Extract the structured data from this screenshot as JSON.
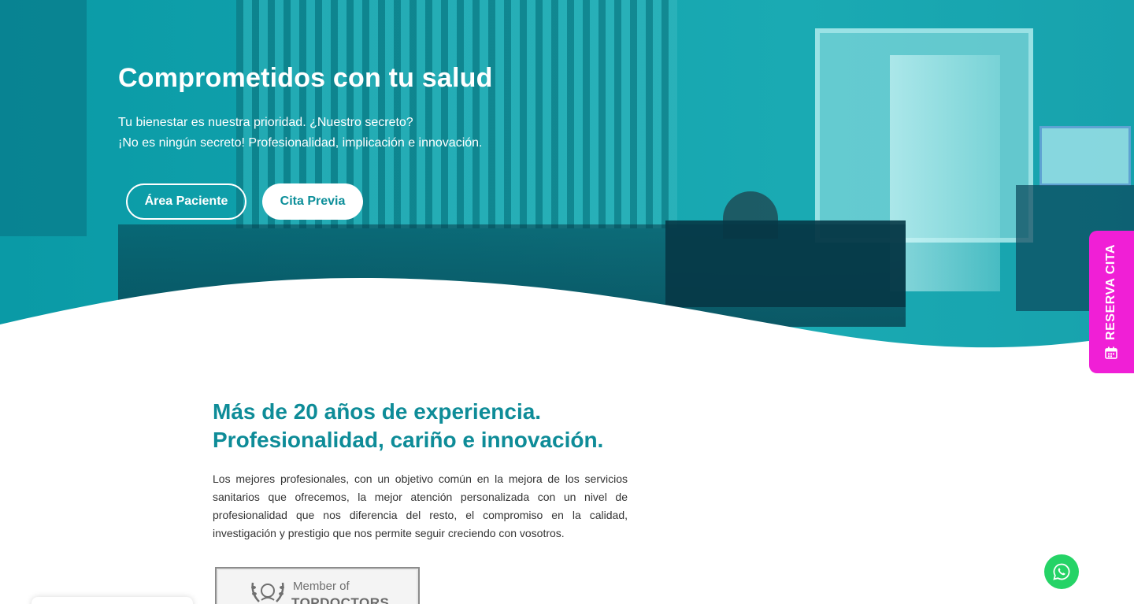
{
  "hero": {
    "title": "Comprometidos con tu salud",
    "subtitle_line1": "Tu bienestar es nuestra prioridad. ¿Nuestro secreto?",
    "subtitle_line2": "¡No es ningún secreto! Profesionalidad, implicación e innovación.",
    "button_patient_area": "Área Paciente",
    "button_appointment": "Cita Previa"
  },
  "reserve_tab": {
    "label": "RESERVA CITA",
    "icon": "calendar-icon"
  },
  "about": {
    "title_line1": "Más de 20 años de experiencia.",
    "title_line2": "Profesionalidad, cariño e innovación.",
    "body": "Los mejores profesionales, con un objetivo común en la mejora de los servicios sanitarios que ofrecemos, la mejor atención personalizada con un nivel de profesionalidad que nos diferencia del resto, el compromiso en la calidad, investigación y prestigio que nos permite seguir creciendo con vosotros."
  },
  "badge": {
    "member_text": "Member of",
    "brand_text": "TOPDOCTORS"
  },
  "whatsapp": {
    "icon": "whatsapp-icon"
  },
  "colors": {
    "accent": "#0e8c98",
    "hero_teal": "#12a3ad",
    "reserve_pink": "#f01fd6",
    "whatsapp_green": "#25d366"
  }
}
